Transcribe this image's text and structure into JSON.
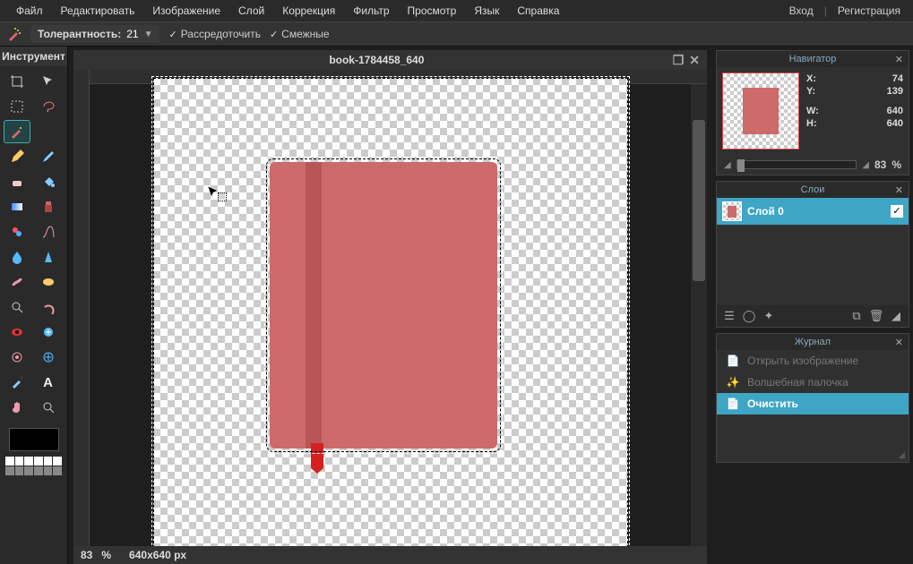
{
  "menu": {
    "items": [
      "Файл",
      "Редактировать",
      "Изображение",
      "Слой",
      "Коррекция",
      "Фильтр",
      "Просмотр",
      "Язык",
      "Справка"
    ],
    "login": "Вход",
    "register": "Регистрация"
  },
  "options": {
    "tolerance_label": "Толерантность:",
    "tolerance_value": "21",
    "antialias": "Рассредоточить",
    "contiguous": "Смежные"
  },
  "toolbox": {
    "title": "Инструмент"
  },
  "document": {
    "title": "book-1784458_640"
  },
  "status": {
    "zoom": "83",
    "zoom_unit": "%",
    "dims": "640x640 px"
  },
  "navigator": {
    "title": "Навигатор",
    "x_label": "X:",
    "x": "74",
    "y_label": "Y:",
    "y": "139",
    "w_label": "W:",
    "w": "640",
    "h_label": "H:",
    "h": "640",
    "zoom": "83",
    "zoom_unit": "%"
  },
  "layers": {
    "title": "Слои",
    "layer0": "Слой 0"
  },
  "history": {
    "title": "Журнал",
    "items": [
      {
        "label": "Открыть изображение",
        "icon": "📄",
        "active": false
      },
      {
        "label": "Волшебная палочка",
        "icon": "✨",
        "active": false
      },
      {
        "label": "Очистить",
        "icon": "📄",
        "active": true
      }
    ]
  },
  "palette_colors": [
    "#fff",
    "#fff",
    "#fff",
    "#fff",
    "#fff",
    "#fff",
    "#888",
    "#888",
    "#888",
    "#888",
    "#888",
    "#888"
  ]
}
